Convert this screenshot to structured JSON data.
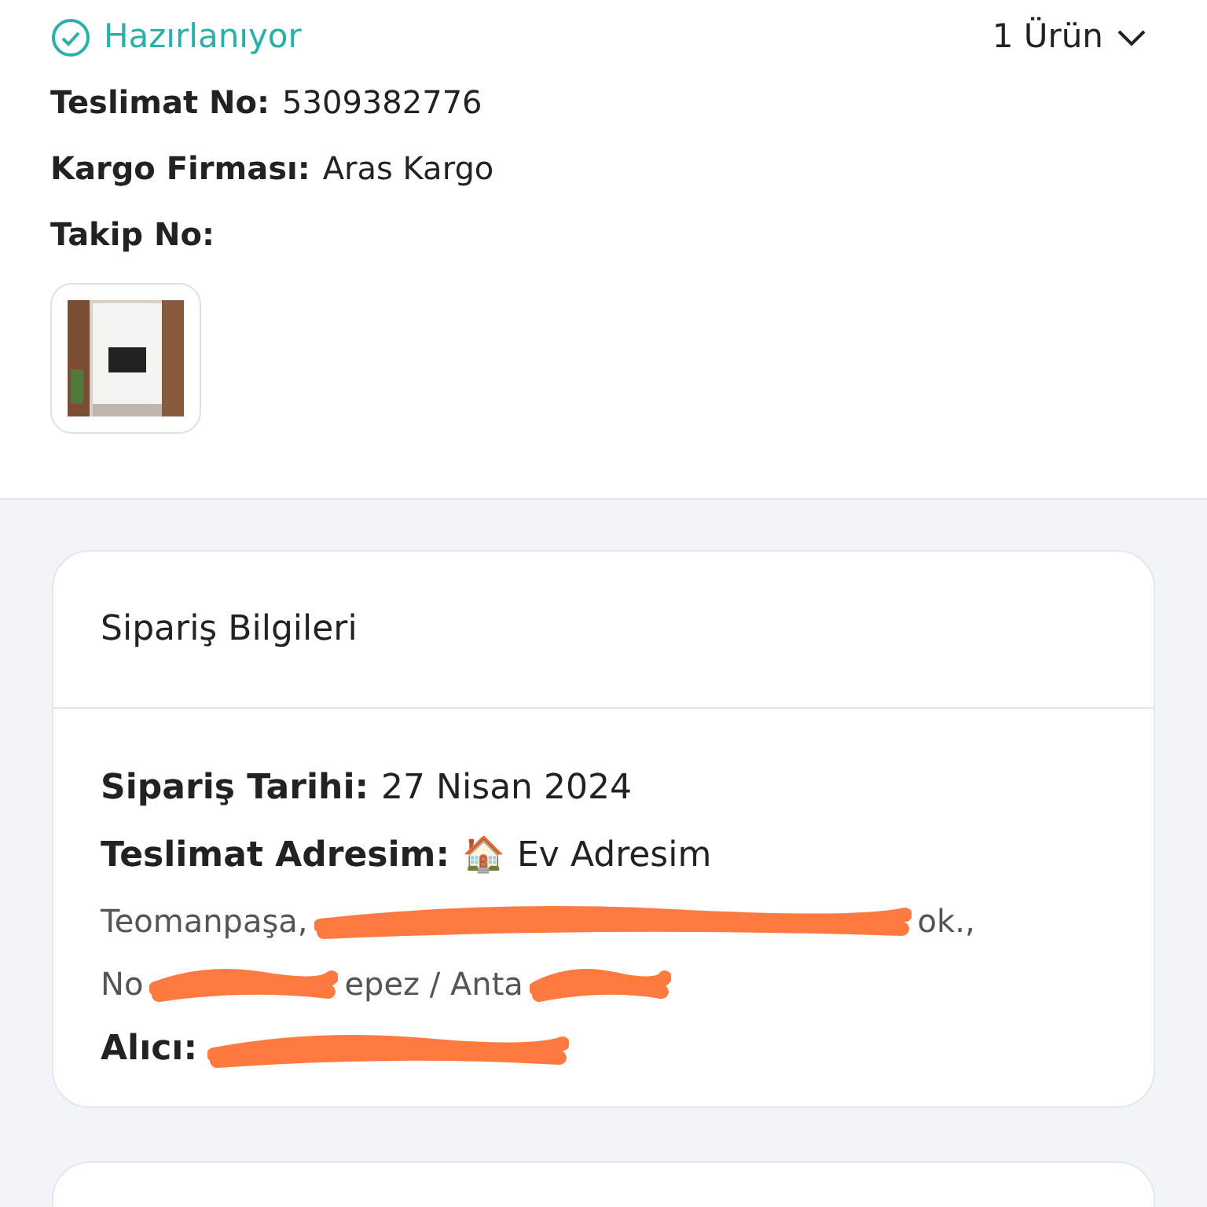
{
  "shipment": {
    "status": "Hazırlanıyor",
    "item_count": "1 Ürün",
    "expanded": false,
    "fields": [
      {
        "label": "Teslimat No:",
        "value": "5309382776"
      },
      {
        "label": "Kargo Firması:",
        "value": "Aras Kargo"
      },
      {
        "label": "Takip No:"
      }
    ]
  },
  "order_info": {
    "title": "Sipariş Bilgileri",
    "date_label": "Sipariş Tarihi:",
    "date": "27 Nisan 2024",
    "address_label": "Teslimat Adresim:",
    "address_icon": "🏠",
    "address_name": "Ev Adresim",
    "address_lines": [
      [
        "Teomanpaşa,",
        "ok.,"
      ],
      [
        "No",
        "epez / Anta"
      ]
    ],
    "recipient_label": "Alıcı:"
  }
}
